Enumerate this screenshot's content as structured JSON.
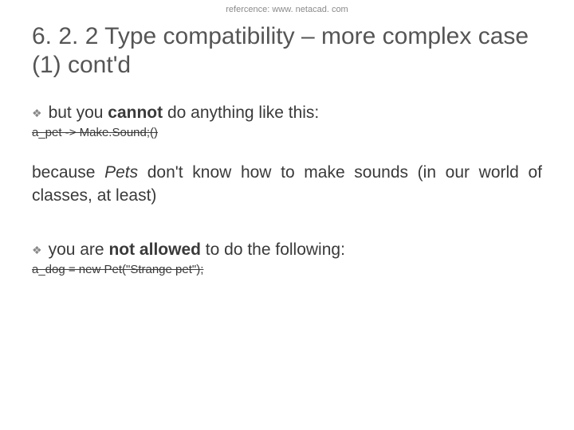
{
  "reference": "refercence: www. netacad. com",
  "title": "6. 2. 2 Type compatibility – more complex case (1) cont'd",
  "bullet1_pre": "but you ",
  "bullet1_bold": "cannot",
  "bullet1_post": " do anything like this:",
  "code1": "a_pet -> Make.Sound;()",
  "para_pre": "because ",
  "para_italic": "Pets",
  "para_post": " don't know how to make sounds (in our world of classes, at least)",
  "bullet2_pre": "you are ",
  "bullet2_bold": "not allowed",
  "bullet2_post": " to do the following:",
  "code2": "a_dog = new Pet(\"Strange pet\");"
}
